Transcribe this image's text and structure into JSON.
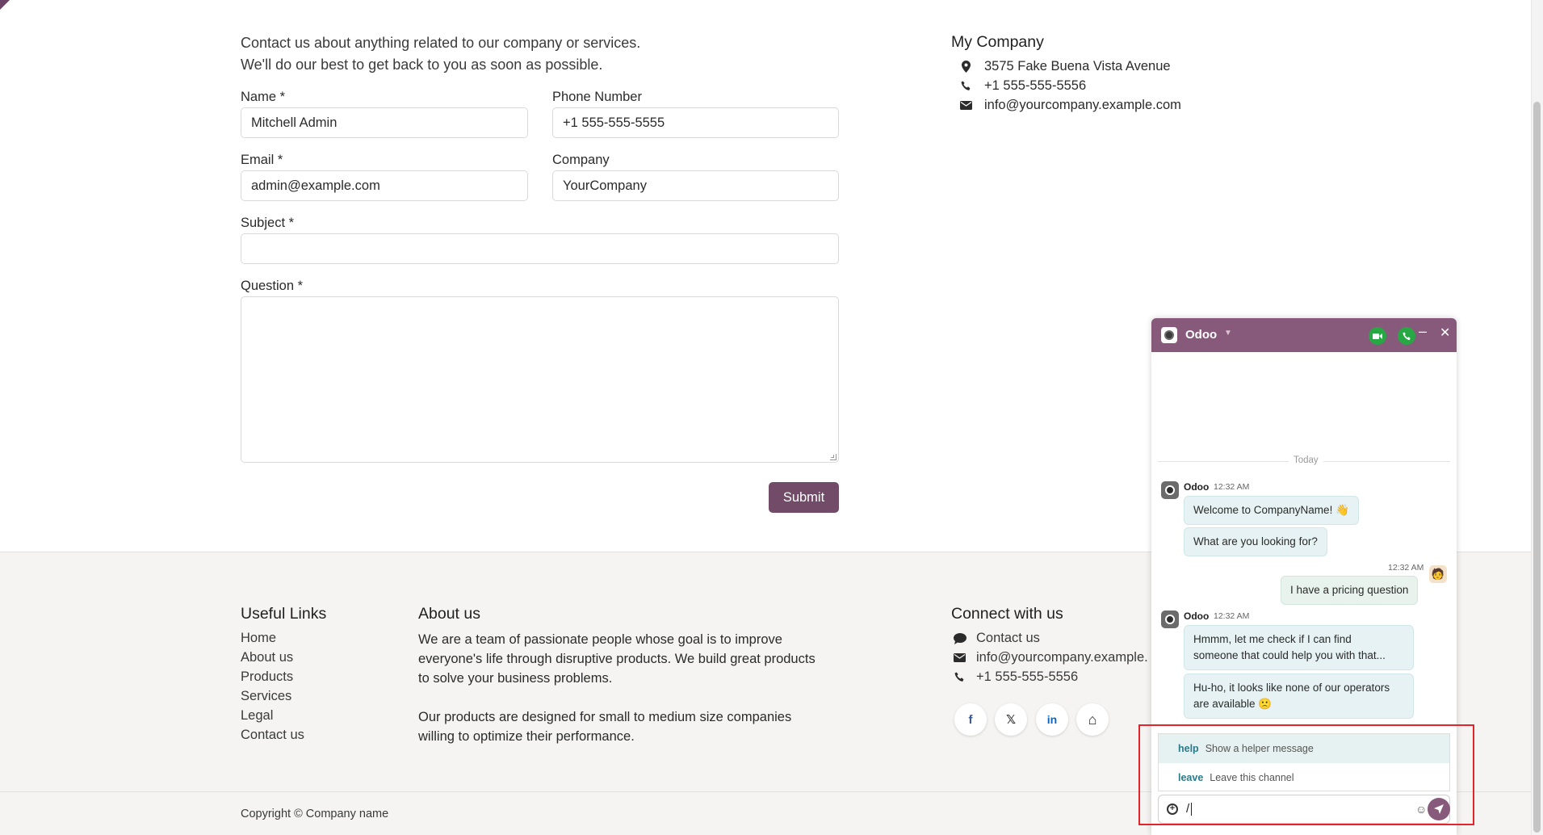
{
  "intro": {
    "line1": "Contact us about anything related to our company or services.",
    "line2": "We'll do our best to get back to you as soon as possible."
  },
  "form": {
    "name_label": "Name *",
    "name_value": "Mitchell Admin",
    "phone_label": "Phone Number",
    "phone_value": "+1 555-555-5555",
    "email_label": "Email *",
    "email_value": "admin@example.com",
    "company_label": "Company",
    "company_value": "YourCompany",
    "subject_label": "Subject *",
    "subject_value": "",
    "question_label": "Question *",
    "question_value": "",
    "submit_label": "Submit"
  },
  "company": {
    "title": "My Company",
    "address": "3575 Fake Buena Vista Avenue",
    "phone": "+1 555-555-5556",
    "email": "info@yourcompany.example.com"
  },
  "footer": {
    "useful_links_title": "Useful Links",
    "links": [
      "Home",
      "About us",
      "Products",
      "Services",
      "Legal",
      "Contact us"
    ],
    "about_title": "About us",
    "about_lines": [
      "We are a team of passionate people whose goal is to improve",
      "everyone's life through disruptive products. We build great products",
      "to solve your business problems.",
      "Our products are designed for small to medium size companies",
      "willing to optimize their performance."
    ],
    "connect_title": "Connect with us",
    "connect_contact": "Contact us",
    "connect_email": "info@yourcompany.example.",
    "connect_phone": "+1 555-555-5556",
    "social": {
      "facebook": "f",
      "x": "𝕏",
      "linkedin": "in",
      "home": "⌂"
    },
    "copyright": "Copyright © Company name"
  },
  "chat": {
    "title": "Odoo",
    "day_separator": "Today",
    "messages": [
      {
        "author": "Odoo",
        "time": "12:32 AM"
      },
      {
        "text": "Welcome to CompanyName! 👋"
      },
      {
        "text": "What are you looking for?"
      },
      {
        "time": "12:32 AM",
        "text": "I have a pricing question"
      },
      {
        "author": "Odoo",
        "time": "12:32 AM"
      },
      {
        "text_line1": "Hmmm, let me check if I can find",
        "text_line2": "someone that could help you with that..."
      },
      {
        "text_line1": "Hu-ho, it looks like none of our operators",
        "text_line2": "are available 🙁"
      }
    ],
    "suggestions": [
      {
        "command": "help",
        "description": "Show a helper message"
      },
      {
        "command": "leave",
        "description": "Leave this channel"
      }
    ],
    "composer_value": "/"
  },
  "colors": {
    "brand": "#714b67",
    "chat_header": "#875a7b",
    "call_green": "#28a745",
    "highlight": "#e4242b"
  }
}
